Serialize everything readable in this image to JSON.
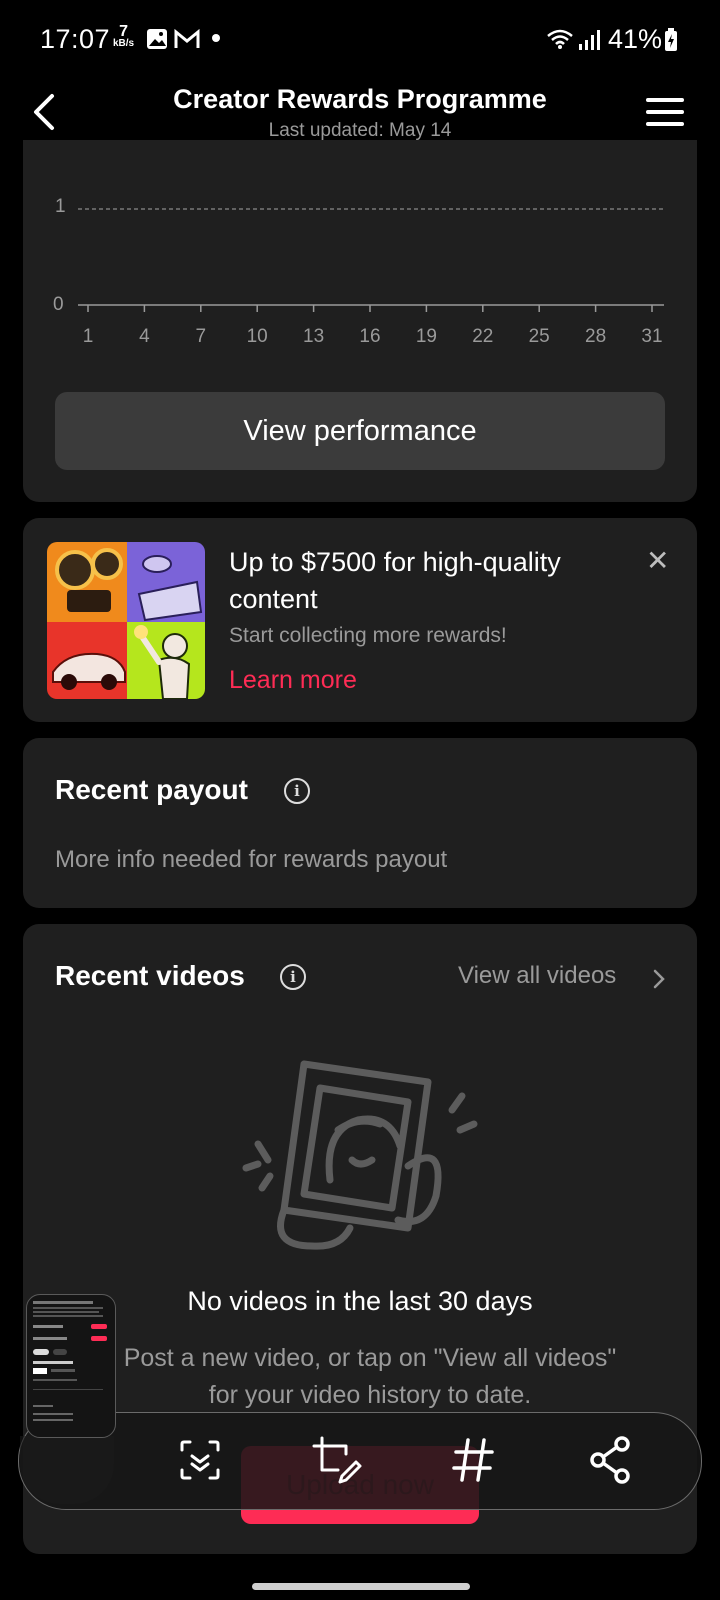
{
  "status_bar": {
    "time": "17:07",
    "net_speed_value": "7",
    "net_speed_unit": "kB/s",
    "battery": "41%"
  },
  "header": {
    "title": "Creator Rewards Programme",
    "subtitle": "Last updated: May 14"
  },
  "chart": {
    "chart_data": {
      "type": "line",
      "y_ticks": [
        "1",
        "0"
      ],
      "x_ticks": [
        "1",
        "4",
        "7",
        "10",
        "13",
        "16",
        "19",
        "22",
        "25",
        "28",
        "31"
      ],
      "ylim": [
        0,
        1
      ],
      "grid": "dashed line at y=1"
    },
    "button_label": "View performance"
  },
  "promo": {
    "title": "Up to $7500 for high-quality content",
    "subtitle": "Start collecting more rewards!",
    "link": "Learn more",
    "close_glyph": "✕"
  },
  "payout": {
    "title": "Recent payout",
    "message": "More info needed for rewards payout"
  },
  "videos": {
    "title": "Recent videos",
    "view_all": "View all videos",
    "empty_title": "No videos in the last 30 days",
    "empty_subtitle": "Post a new video, or tap on \"View all videos\" for your video history to date.",
    "upload_label": "Upload now"
  },
  "toolbar": {
    "items": [
      "scan-icon",
      "crop-edit-icon",
      "hashtag-icon",
      "share-icon"
    ]
  },
  "colors": {
    "accent": "#fe2c55",
    "card": "#1f1f1f",
    "button": "#3b3b3b"
  }
}
